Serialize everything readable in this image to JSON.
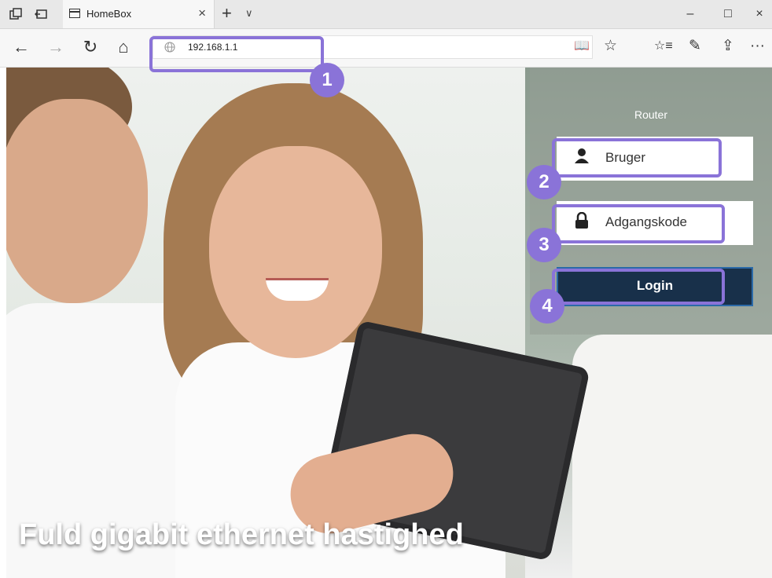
{
  "browser": {
    "tab_title": "HomeBox",
    "url": "192.168.1.1",
    "tab_close": "×",
    "new_tab": "+",
    "tab_list": "∨",
    "minimize": "–",
    "maximize": "□",
    "close": "×",
    "back": "←",
    "forward": "→",
    "refresh": "↻",
    "home": "⌂",
    "reading_view": "📖",
    "favorite": "☆",
    "favorites_hub": "☆≡",
    "notes": "✎",
    "share": "⇪",
    "more": "···"
  },
  "page": {
    "panel_title": "Router",
    "user_label": "Bruger",
    "password_label": "Adgangskode",
    "login_label": "Login",
    "headline": "Fuld gigabit ethernet hastighed"
  },
  "annotations": {
    "badge1": "1",
    "badge2": "2",
    "badge3": "3",
    "badge4": "4",
    "color": "#8a73d8"
  }
}
